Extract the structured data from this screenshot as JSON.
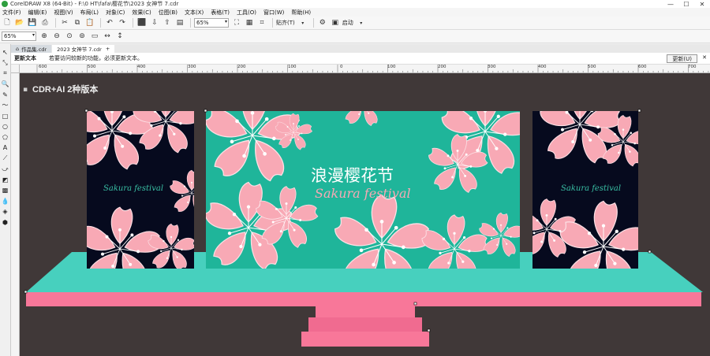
{
  "titlebar": {
    "title": "CorelDRAW X8 (64-Bit) - F:\\0 HT\\fafa\\樱花节\\2023 女神节 7.cdr",
    "minimize": "—",
    "maximize": "☐",
    "close": "✕"
  },
  "menu": [
    "文件(F)",
    "编辑(E)",
    "视图(V)",
    "布局(L)",
    "对象(C)",
    "效果(C)",
    "位图(B)",
    "文本(X)",
    "表格(T)",
    "工具(O)",
    "窗口(W)",
    "帮助(H)"
  ],
  "toolbar": {
    "zoom_value": "65%",
    "snap_label": "贴齐(T)",
    "launch_label": "启动"
  },
  "propbar": {
    "zoom_value": "65%"
  },
  "tabs": [
    {
      "label": "作品集.cdr"
    },
    {
      "label": "2023 女神节 7.cdr"
    }
  ],
  "notice": {
    "title": "更新文本",
    "message": "若要访问较新的功能，必须更新文本。",
    "button": "更新(U)"
  },
  "ruler": [
    "600",
    "500",
    "400",
    "300",
    "200",
    "100",
    "0",
    "100",
    "200",
    "300",
    "400",
    "500",
    "600",
    "700"
  ],
  "artwork": {
    "caption": "CDR+AI 2种版本",
    "title_cn": "浪漫樱花节",
    "script_text": "Sakura festival",
    "colors": {
      "canvas": "#403838",
      "teal": "#1fb59a",
      "navy": "#060a1e",
      "pink": "#f8a9b5",
      "stage_top": "#47d0be",
      "stage_front": "#f87799"
    }
  }
}
